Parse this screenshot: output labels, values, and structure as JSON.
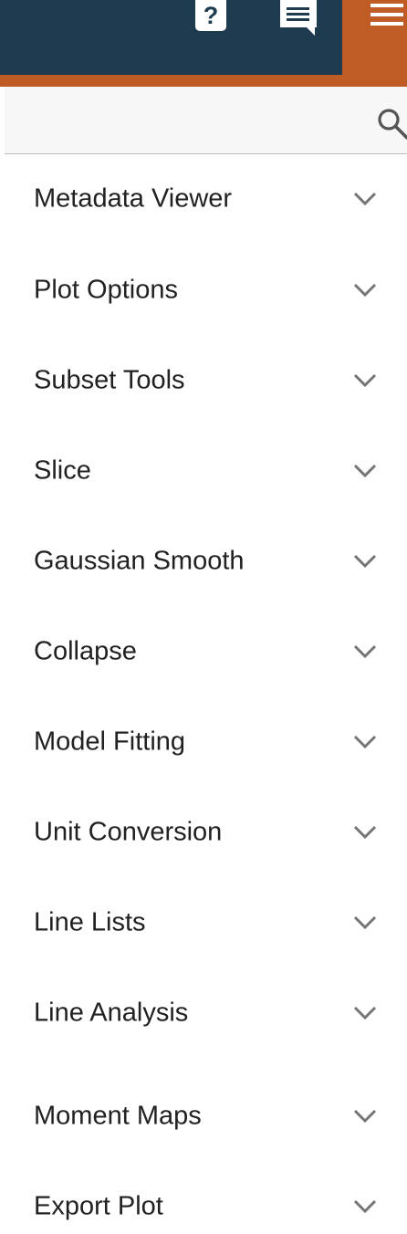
{
  "header": {
    "help_label": "?",
    "icons": [
      "help-icon",
      "chat-icon",
      "hamburger-menu-icon"
    ],
    "colors": {
      "dark_bar": "#1f3b4f",
      "accent": "#bf5b25"
    }
  },
  "search": {
    "value": "",
    "placeholder": ""
  },
  "tray": {
    "items": [
      {
        "label": "Metadata Viewer"
      },
      {
        "label": "Plot Options"
      },
      {
        "label": "Subset Tools"
      },
      {
        "label": "Slice"
      },
      {
        "label": "Gaussian Smooth"
      },
      {
        "label": "Collapse"
      },
      {
        "label": "Model Fitting"
      },
      {
        "label": "Unit Conversion"
      },
      {
        "label": "Line Lists"
      },
      {
        "label": "Line Analysis"
      },
      {
        "label": "Moment Maps"
      },
      {
        "label": "Export Plot"
      }
    ],
    "expand_icon": "chevron-down-icon"
  }
}
